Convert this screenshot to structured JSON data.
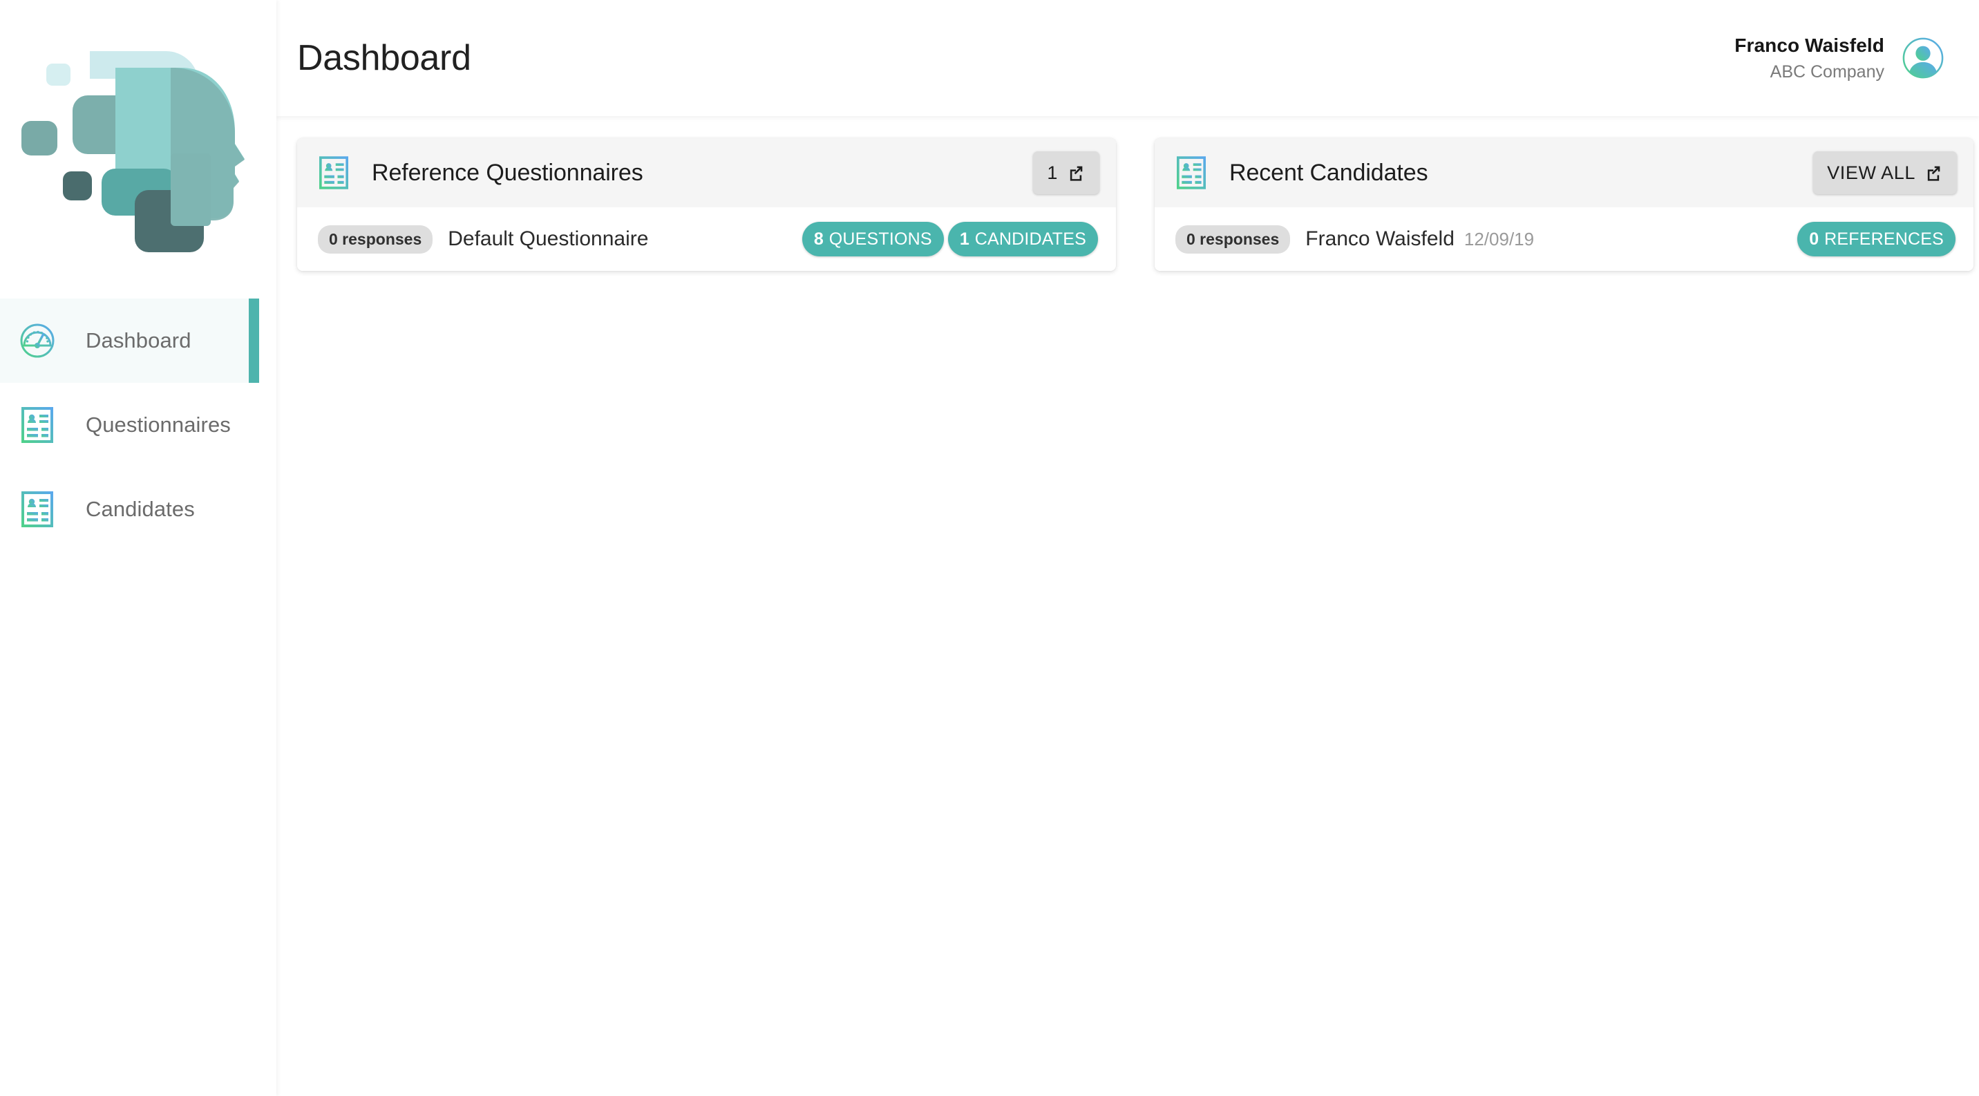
{
  "brand": {
    "logo_icon": "head-profile-logo",
    "accent_teal": "#4ab5ad",
    "gradient_start": "#5aa9ec",
    "gradient_end": "#4fd18b"
  },
  "sidebar": {
    "items": [
      {
        "label": "Dashboard",
        "icon": "speedometer-icon",
        "active": true
      },
      {
        "label": "Questionnaires",
        "icon": "id-card-icon",
        "active": false
      },
      {
        "label": "Candidates",
        "icon": "id-card-icon",
        "active": false
      }
    ]
  },
  "header": {
    "title": "Dashboard",
    "user": {
      "name": "Franco Waisfeld",
      "company": "ABC Company",
      "avatar_icon": "user-avatar-icon"
    }
  },
  "cards": [
    {
      "title": "Reference Questionnaires",
      "icon": "id-card-icon",
      "action": {
        "label": "1",
        "icon": "external-link-icon"
      },
      "row": {
        "chip": "0 responses",
        "name": "Default Questionnaire",
        "date": "",
        "badges": [
          {
            "num": "8",
            "text": "QUESTIONS"
          },
          {
            "num": "1",
            "text": "CANDIDATES"
          }
        ]
      }
    },
    {
      "title": "Recent Candidates",
      "icon": "id-card-icon",
      "action": {
        "label": "VIEW ALL",
        "icon": "external-link-icon"
      },
      "row": {
        "chip": "0 responses",
        "name": "Franco Waisfeld",
        "date": "12/09/19",
        "badges": [
          {
            "num": "0",
            "text": "REFERENCES"
          }
        ]
      }
    }
  ]
}
